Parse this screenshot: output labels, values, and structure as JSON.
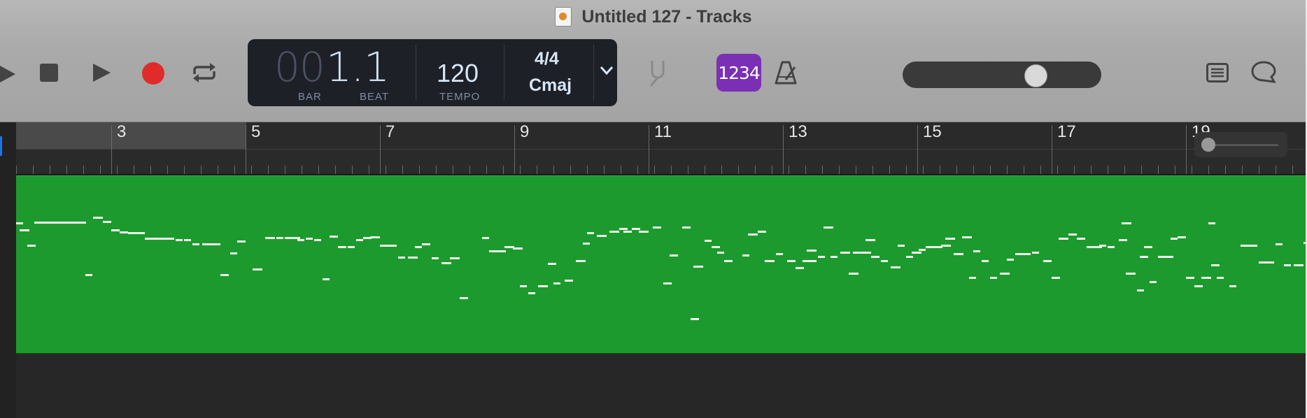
{
  "window": {
    "title": "Untitled 127 - Tracks"
  },
  "toolbar": {
    "buttons": [
      {
        "name": "rewind-button",
        "icon": "rewind-icon"
      },
      {
        "name": "stop-button",
        "icon": "stop-icon"
      },
      {
        "name": "play-button",
        "icon": "play-icon"
      },
      {
        "name": "record-button",
        "icon": "record-icon"
      },
      {
        "name": "cycle-button",
        "icon": "cycle-icon"
      }
    ],
    "colors": {
      "record": "#e02b2b",
      "count_in": "#7a2fb4",
      "region": "#1c9a2e"
    }
  },
  "lcd": {
    "bar_dim": "00",
    "bar_value": "1.",
    "beat_value": "1",
    "bar_caption": "BAR",
    "beat_caption": "BEAT",
    "tempo": "120",
    "tempo_caption": "TEMPO",
    "time_signature": "4/4",
    "key": "Cmaj"
  },
  "count_in": {
    "label": "1234"
  },
  "master_volume": {
    "level": 0.62
  },
  "ruler": {
    "bars": [
      "3",
      "5",
      "7",
      "9",
      "11",
      "13",
      "15",
      "17",
      "19"
    ]
  },
  "zoom": {
    "level": 0.05
  }
}
